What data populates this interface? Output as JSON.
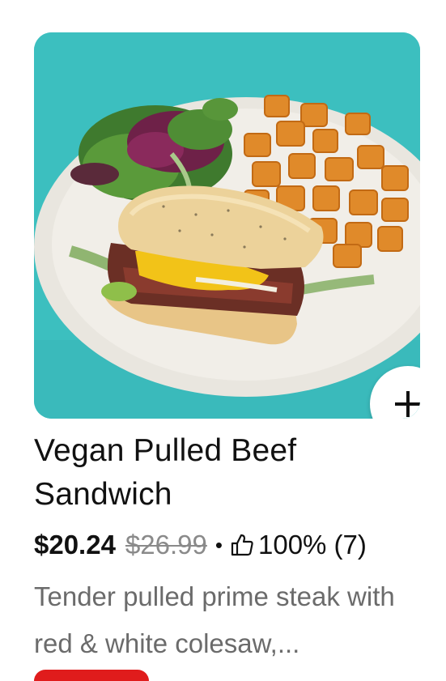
{
  "item": {
    "title": "Vegan Pulled Beef Sandwich",
    "price": "$20.24",
    "original_price": "$26.99",
    "separator": "•",
    "rating": "100% (7)",
    "description": "Tender pulled prime steak with red & white colesaw,..."
  },
  "icons": {
    "add": "plus-icon",
    "rating": "thumbs-up-icon"
  },
  "colors": {
    "image_background": "#3cbfbf",
    "promo_badge": "#e01c1c",
    "original_price": "#8a8a8a",
    "description": "#6b6b6b"
  }
}
